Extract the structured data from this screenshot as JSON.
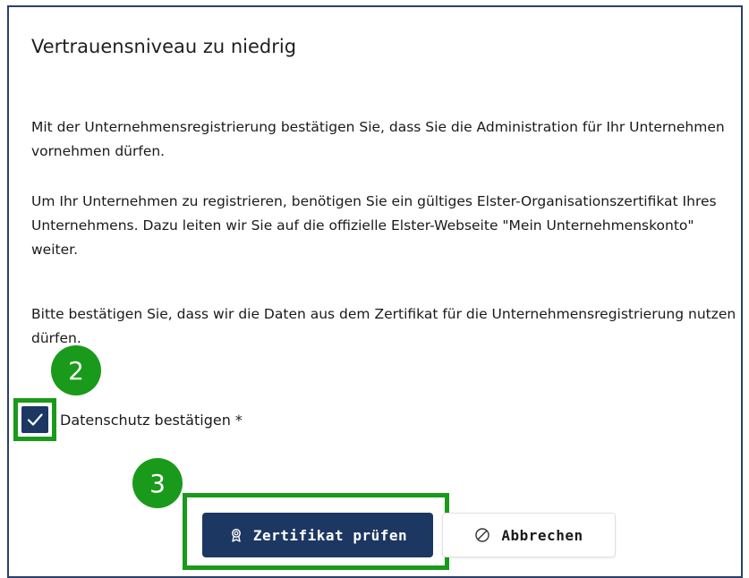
{
  "dialog": {
    "title": "Vertrauensniveau zu niedrig",
    "paragraphs": [
      "Mit der Unternehmensregistrierung bestätigen Sie, dass Sie die Administration für Ihr Unternehmen vornehmen dürfen.",
      "Um Ihr Unternehmen zu registrieren, benötigen Sie ein gültiges Elster-Organisationszertifikat Ihres Unternehmens. Dazu leiten wir Sie auf die offizielle Elster-Webseite \"Mein Unternehmenskonto\" weiter.",
      "Bitte bestätigen Sie, dass wir die Daten aus dem Zertifikat für die Unternehmensregistrierung nutzen dürfen."
    ],
    "checkbox": {
      "label": "Datenschutz bestätigen *",
      "checked": true
    },
    "buttons": {
      "primary_label": "Zertifikat prüfen",
      "primary_icon": "certificate-icon",
      "secondary_label": "Abbrechen",
      "secondary_icon": "cancel-circle-icon"
    }
  },
  "annotations": {
    "badge_checkbox": "2",
    "badge_button": "3",
    "highlight_color": "#1a9a1a"
  },
  "colors": {
    "primary": "#1d3763",
    "border": "#2a3f6b"
  }
}
